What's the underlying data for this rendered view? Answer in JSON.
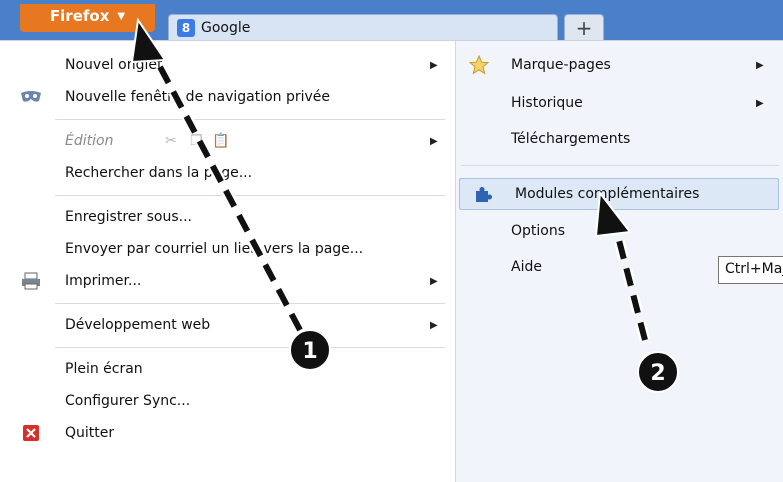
{
  "firefox_button": {
    "label": "Firefox",
    "arrow": "▼"
  },
  "tabs": [
    {
      "label": "Google"
    }
  ],
  "new_tab": {
    "label": "+"
  },
  "left_menu": {
    "new_tab": "Nouvel onglet",
    "private_window": "Nouvelle fenêtre de navigation privée",
    "edit": "Édition",
    "find": "Rechercher dans la page...",
    "save_as": "Enregistrer sous...",
    "email_link": "Envoyer par courriel un lien vers la page...",
    "print": "Imprimer...",
    "web_dev": "Développement web",
    "fullscreen": "Plein écran",
    "sync": "Configurer Sync...",
    "quit": "Quitter"
  },
  "right_menu": {
    "bookmarks": "Marque-pages",
    "history": "Historique",
    "downloads": "Téléchargements",
    "addons": "Modules complémentaires",
    "options": "Options",
    "help": "Aide"
  },
  "tooltip": {
    "text": "Ctrl+Maj+A"
  },
  "annotations": {
    "step1": "1",
    "step2": "2"
  },
  "colors": {
    "firefox_orange": "#e87722",
    "titlebar_blue": "#4a80c9",
    "highlight_bg": "#dde8f6",
    "addon_icon": "#2f64b4"
  }
}
